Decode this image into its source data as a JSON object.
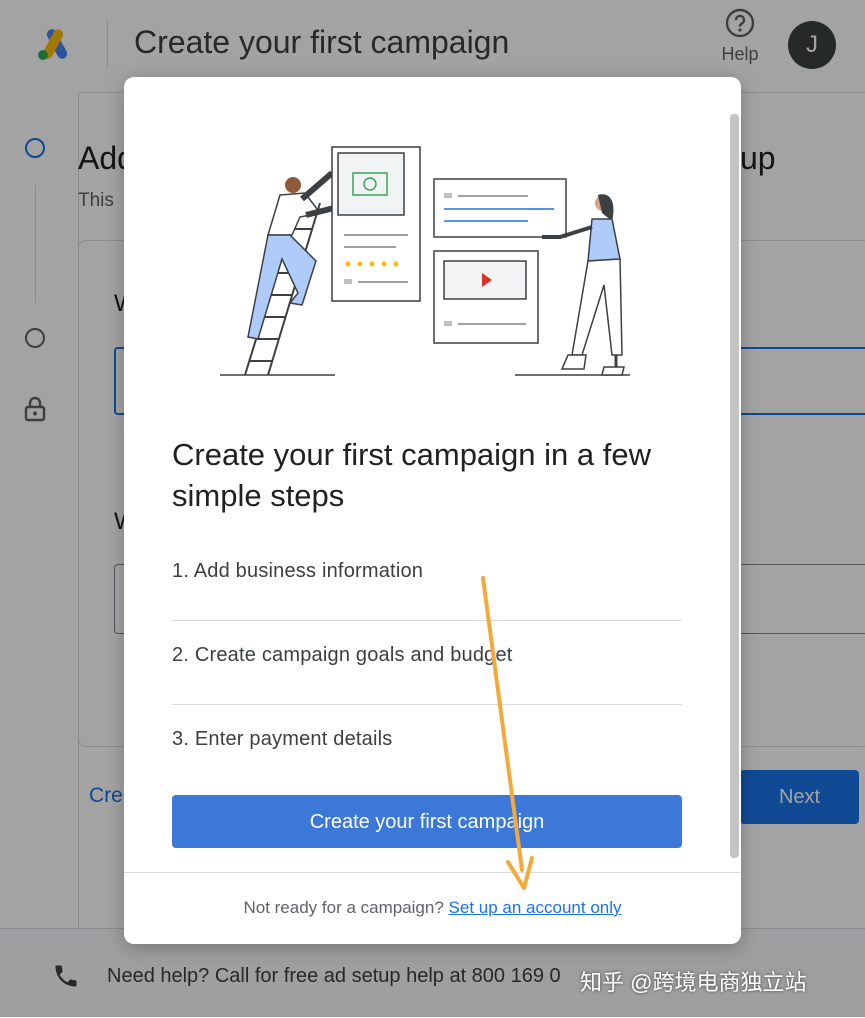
{
  "header": {
    "title": "Create your first campaign",
    "help_label": "Help",
    "avatar_initial": "J"
  },
  "background": {
    "heading_left": "Add",
    "heading_right": "up",
    "subtitle": "This",
    "question_1": "W",
    "question_2": "W",
    "link": "Cre",
    "next_label": "Next"
  },
  "footer": {
    "help_text": "Need help? Call for free ad setup help at 800 169 0",
    "watermark": "知乎 @跨境电商独立站"
  },
  "modal": {
    "title": "Create your first campaign in a few simple steps",
    "steps": [
      "1. Add business information",
      "2. Create campaign goals and budget",
      "3. Enter payment details"
    ],
    "cta_label": "Create your first campaign",
    "footer_prefix": "Not ready for a campaign?",
    "footer_link": "Set up an account only"
  },
  "colors": {
    "accent": "#1a73e8",
    "cta": "#3c78d8",
    "annotation_arrow": "#f4a93b"
  },
  "icons": [
    "google-ads-logo",
    "help-icon",
    "phone-icon",
    "lock-icon",
    "annotation-arrow"
  ]
}
